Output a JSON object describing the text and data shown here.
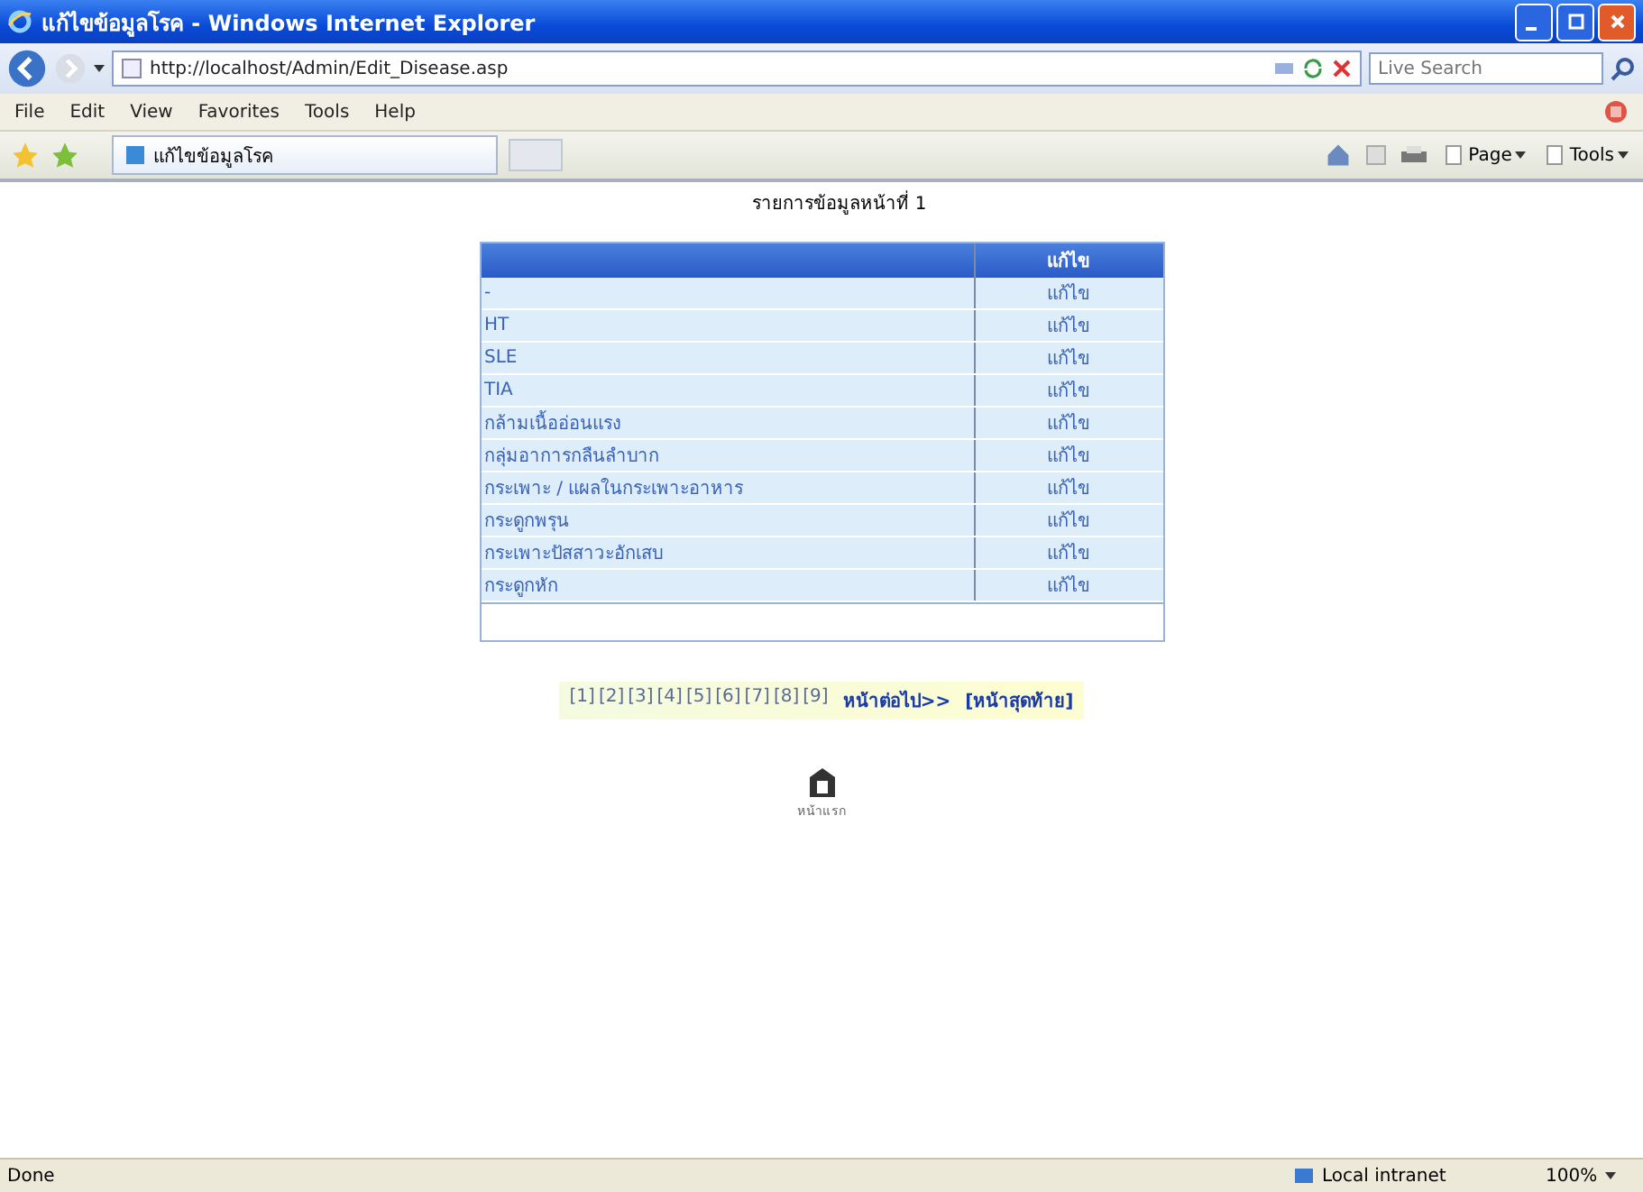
{
  "window": {
    "title": "แก้ไขข้อมูลโรค - Windows Internet Explorer"
  },
  "address_bar": {
    "url": "http://localhost/Admin/Edit_Disease.asp"
  },
  "search": {
    "placeholder": "Live Search"
  },
  "menu": [
    "File",
    "Edit",
    "View",
    "Favorites",
    "Tools",
    "Help"
  ],
  "tab": {
    "title": "แก้ไขข้อมูลโรค"
  },
  "toolbar": [
    {
      "label": "Page"
    },
    {
      "label": "Tools"
    }
  ],
  "page": {
    "heading": "รายการข้อมูลหน้าที่ 1",
    "table": {
      "columns": [
        "",
        "แก้ไข"
      ],
      "rows": [
        {
          "name": "-",
          "action": "แก้ไข"
        },
        {
          "name": "HT",
          "action": "แก้ไข"
        },
        {
          "name": "SLE",
          "action": "แก้ไข"
        },
        {
          "name": "TIA",
          "action": "แก้ไข"
        },
        {
          "name": "กล้ามเนื้ออ่อนแรง",
          "action": "แก้ไข"
        },
        {
          "name": "กลุ่มอาการกลืนลำบาก",
          "action": "แก้ไข"
        },
        {
          "name": "กระเพาะ / แผลในกระเพาะอาหาร",
          "action": "แก้ไข"
        },
        {
          "name": "กระดูกพรุน",
          "action": "แก้ไข"
        },
        {
          "name": "กระเพาะปัสสาวะอักเสบ",
          "action": "แก้ไข"
        },
        {
          "name": "กระดูกหัก",
          "action": "แก้ไข"
        }
      ]
    },
    "pagination": {
      "pages": [
        "[1]",
        "[2]",
        "[3]",
        "[4]",
        "[5]",
        "[6]",
        "[7]",
        "[8]",
        "[9]"
      ],
      "next": "หน้าต่อไป>>",
      "last": "[หน้าสุดท้าย]"
    },
    "home": {
      "caption": "หน้าแรก"
    }
  },
  "status_bar": {
    "status": "Done",
    "zone": "Local intranet",
    "zoom": "100%"
  }
}
